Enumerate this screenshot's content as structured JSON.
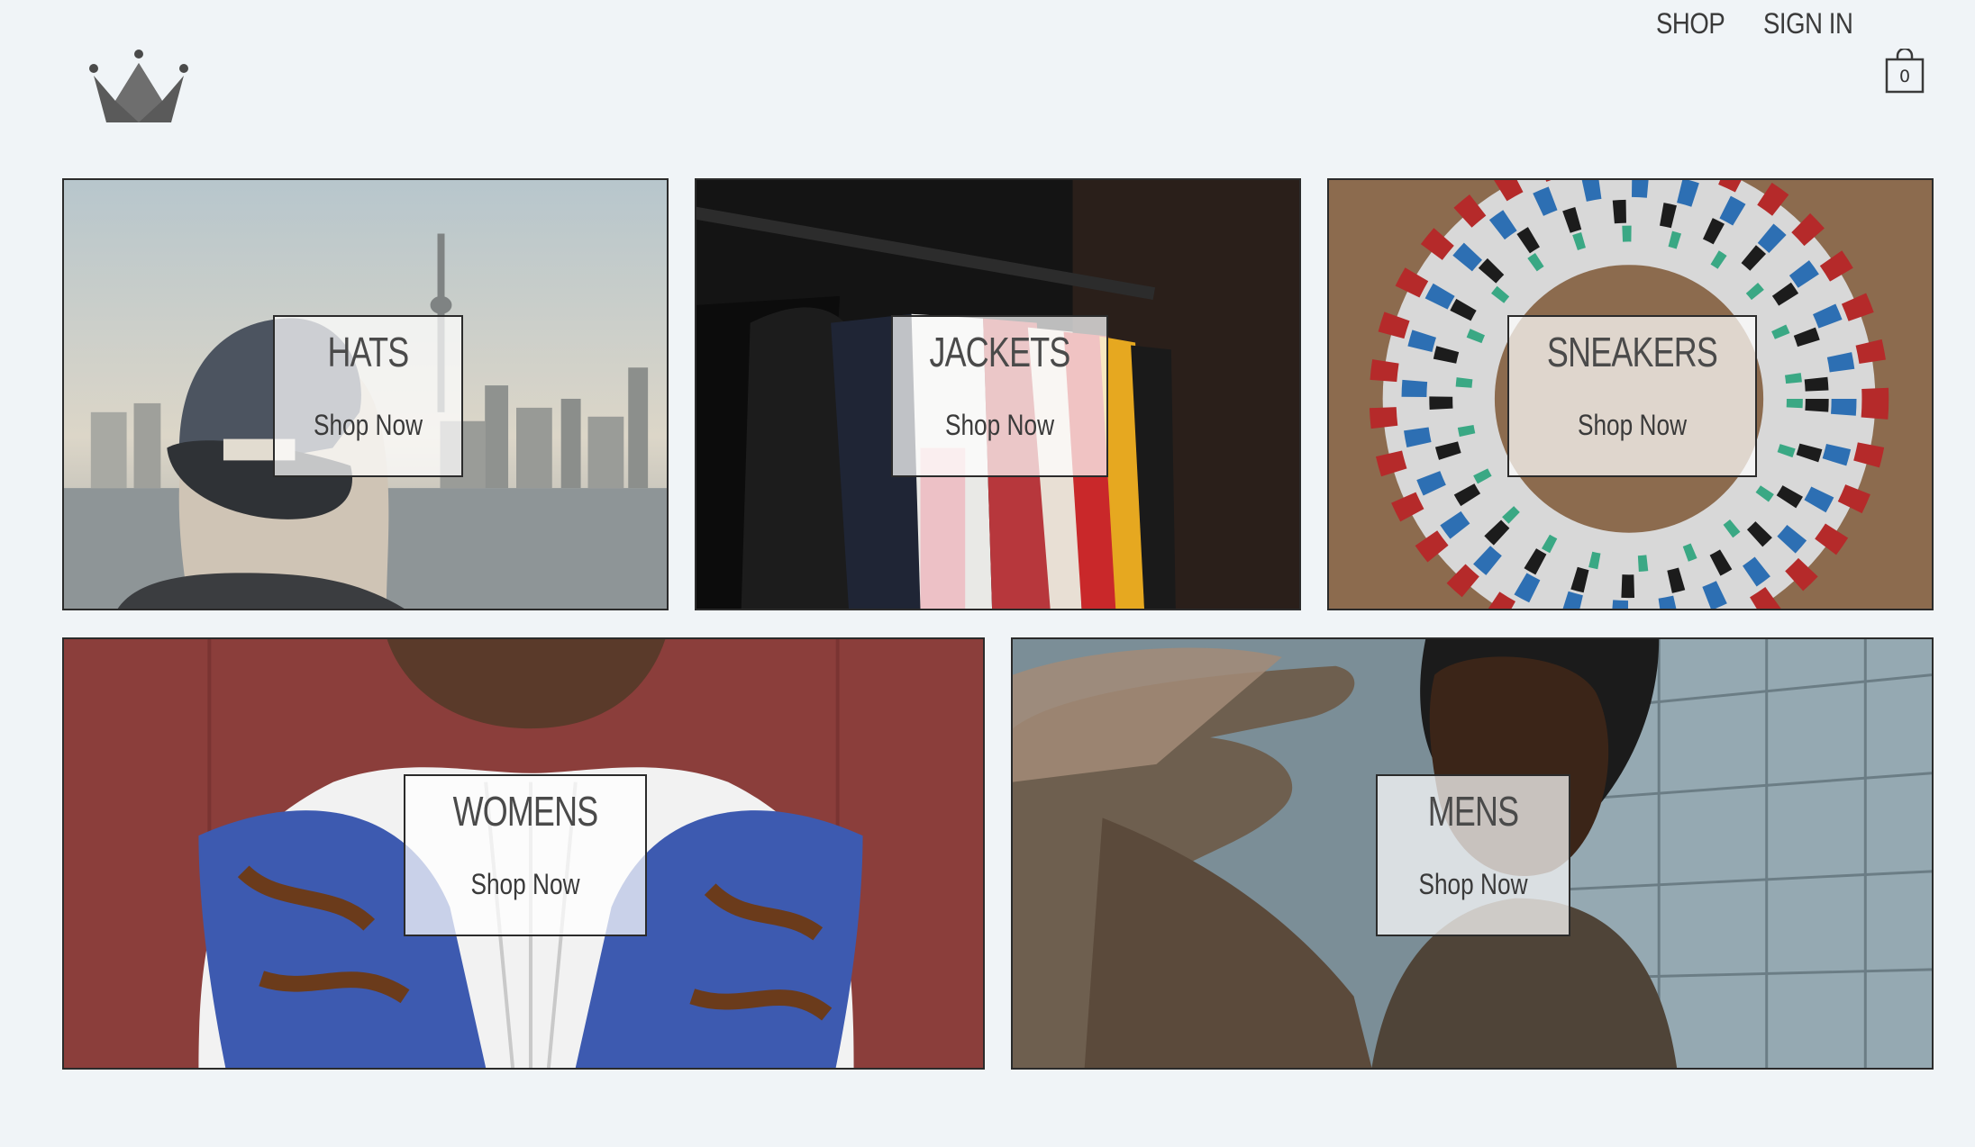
{
  "header": {
    "logo_icon": "crown-icon",
    "nav": {
      "shop_label": "SHOP",
      "signin_label": "SIGN IN"
    },
    "cart": {
      "icon": "shopping-bag-icon",
      "count": "0"
    }
  },
  "categories": [
    {
      "title": "HATS",
      "cta": "Shop Now"
    },
    {
      "title": "JACKETS",
      "cta": "Shop Now"
    },
    {
      "title": "SNEAKERS",
      "cta": "Shop Now"
    },
    {
      "title": "WOMENS",
      "cta": "Shop Now"
    },
    {
      "title": "MENS",
      "cta": "Shop Now"
    }
  ],
  "colors": {
    "page_background": "#f0f4f7",
    "text": "#3a3a3a",
    "border": "#2b2b2b"
  }
}
